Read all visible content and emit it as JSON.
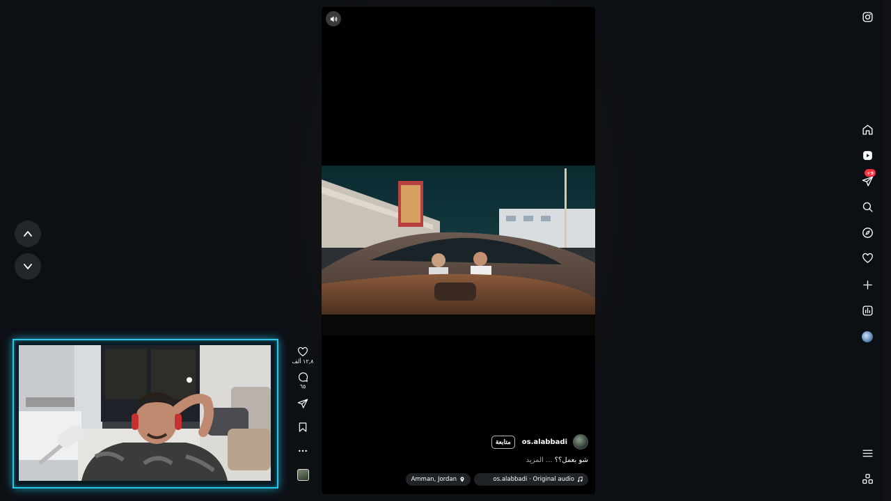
{
  "navigation": {
    "up_icon": "chevron-up-icon",
    "down_icon": "chevron-down-icon"
  },
  "reel": {
    "mute_icon": "speaker-icon",
    "username": "os.alabbadi",
    "follow_label": "متابعة",
    "caption": "شو بعمل؟؟",
    "more_label": "... المزيد",
    "audio_label": "os.alabbadi · Original audio",
    "location_label": "Amman, Jordan"
  },
  "actions": {
    "likes_count": "١٢,٨ ألف",
    "comments_count": "٦٥",
    "icons": [
      "heart-icon",
      "comment-icon",
      "share-icon",
      "bookmark-icon",
      "more-icon"
    ]
  },
  "sidebar": {
    "notifications_badge": "+9",
    "icons": [
      "instagram-icon",
      "home-icon",
      "reels-icon",
      "direct-icon",
      "search-icon",
      "explore-icon",
      "heart-icon",
      "create-icon",
      "dashboard-icon",
      "profile-icon",
      "menu-icon",
      "apps-icon"
    ]
  },
  "colors": {
    "webcam_border": "#28c8ea",
    "badge": "#ff3040",
    "background": "#0c0f14"
  }
}
